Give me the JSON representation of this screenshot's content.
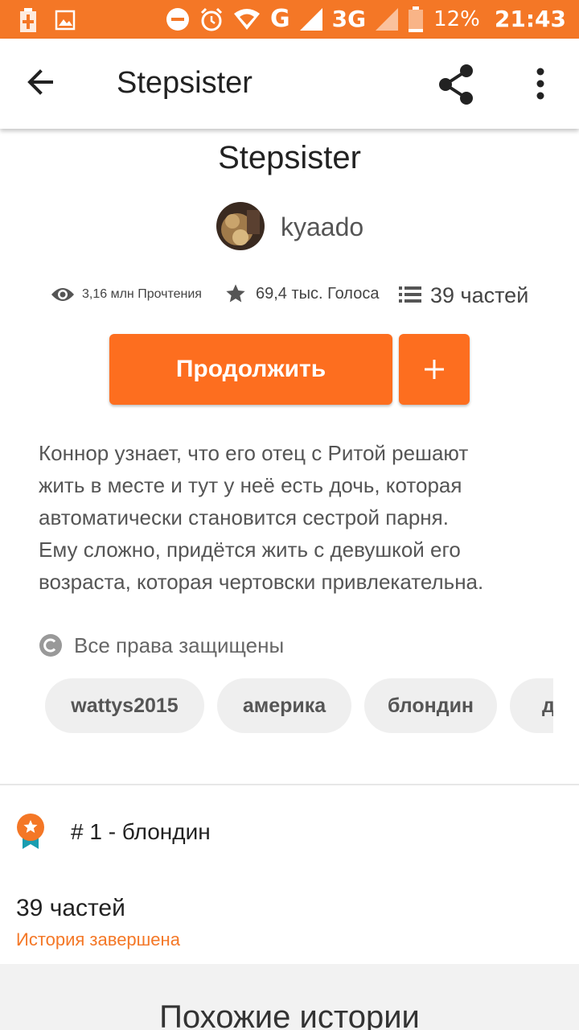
{
  "status_bar": {
    "network_g": "G",
    "network_3g": "3G",
    "battery": "12%",
    "time": "21:43",
    "icons": [
      "battery-charging-icon",
      "image-icon",
      "do-not-disturb-icon",
      "alarm-icon",
      "wifi-icon",
      "signal-icon",
      "battery-icon"
    ]
  },
  "app_bar": {
    "title": "Stepsister",
    "icons": [
      "back-arrow-icon",
      "share-icon",
      "more-vert-icon"
    ]
  },
  "story": {
    "title": "Stepsister",
    "author": "kyaado",
    "stats": {
      "reads": "3,16 млн Прочтения",
      "votes": "69,4 тыс. Голоса",
      "parts": "39 частей"
    },
    "continue_label": "Продолжить",
    "description_lines": [
      "Коннор узнает, что его отец с Ритой решают",
      "жить в месте и тут у неё есть дочь, которая",
      "автоматически становится сестрой парня.",
      "Ему сложно, придётся жить с девушкой его",
      "возраста, которая чертовски привлекательна."
    ],
    "copyright": "Все права защищены",
    "tags": [
      "wattys2015",
      "америка",
      "блондин",
      "д"
    ],
    "rank": "# 1 - блондин",
    "parts_count": "39 частей",
    "completion_status": "История завершена"
  },
  "similar": {
    "title": "Похожие истории"
  },
  "colors": {
    "accent": "#f47726",
    "button": "#fd6e1f",
    "tag_bg": "#efefef",
    "ribbon": "#1a9db0"
  }
}
